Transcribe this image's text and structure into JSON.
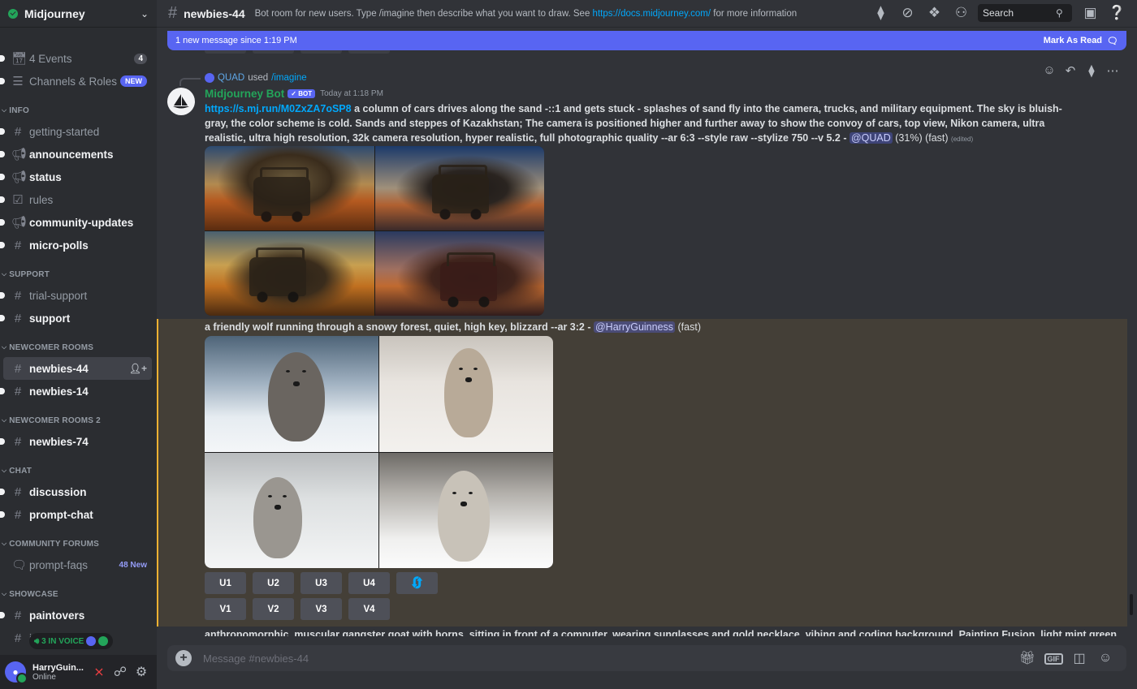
{
  "server": {
    "name": "Midjourney"
  },
  "sidebar": {
    "top_items": [
      {
        "label": "4 Events",
        "icon": "calendar-icon",
        "badge": "4"
      },
      {
        "label": "Channels & Roles",
        "icon": "channels-roles-icon",
        "badge": "NEW"
      }
    ],
    "categories": [
      {
        "name": "INFO",
        "channels": [
          "getting-started",
          "announcements",
          "status",
          "rules",
          "community-updates",
          "micro-polls"
        ]
      },
      {
        "name": "SUPPORT",
        "channels": [
          "trial-support",
          "support"
        ]
      },
      {
        "name": "NEWCOMER ROOMS",
        "channels": [
          "newbies-44",
          "newbies-14"
        ]
      },
      {
        "name": "NEWCOMER ROOMS 2",
        "channels": [
          "newbies-74"
        ]
      },
      {
        "name": "CHAT",
        "channels": [
          "discussion",
          "prompt-chat"
        ]
      },
      {
        "name": "COMMUNITY FORUMS",
        "channels": [
          "prompt-faqs"
        ],
        "forum_badge": "48 New"
      },
      {
        "name": "SHOWCASE",
        "channels": [
          "paintovers",
          "in-the-world"
        ]
      }
    ],
    "voice_pill": "3 IN VOICE"
  },
  "user": {
    "name": "HarryGuin...",
    "status": "Online"
  },
  "topbar": {
    "channel": "newbies-44",
    "topic_prefix": "Bot room for new users. Type /imagine then describe what you want to draw. See ",
    "topic_link": "https://docs.midjourney.com/",
    "topic_suffix": " for more information",
    "search_placeholder": "Search"
  },
  "banner": {
    "text": "1 new message since 1:19 PM",
    "action": "Mark As Read"
  },
  "message1": {
    "reply_user": "QUAD",
    "reply_used": "used",
    "reply_command": "/imagine",
    "author": "Midjourney Bot",
    "bot_tag": "BOT",
    "timestamp": "Today at 1:18 PM",
    "link": "https://s.mj.run/M0ZxZA7oSP8",
    "prompt": " a column of cars drives along the sand -::1 and gets stuck - splashes of sand fly into the camera, trucks, and military equipment. The sky is bluish-gray, the color scheme is cold. Sands and steppes of Kazakhstan; The camera is positioned higher and further away to show the convoy of cars, top view, Nikon camera, ultra realistic, ultra high resolution, 32k camera resolution, hyper realistic, full photographic quality --ar 6:3 --style raw --stylize 750 --v 5.2 - ",
    "mention": "@QUAD",
    "status": " (31%) (fast) ",
    "edited": "(edited)"
  },
  "message2": {
    "prompt": "a friendly wolf running through a snowy forest, quiet, high key, blizzard --ar 3:2 - ",
    "mention": "@HarryGuinness",
    "status": " (fast)",
    "upscale_buttons": [
      "U1",
      "U2",
      "U3",
      "U4"
    ],
    "variation_buttons": [
      "V1",
      "V2",
      "V3",
      "V4"
    ]
  },
  "message3": {
    "prompt": "anthropomorphic, muscular gangster goat with horns, sitting in front of a computer, wearing sunglasses and gold necklace, vibing and coding background, Painting Fusion, light mint green"
  },
  "composer": {
    "placeholder": "Message #newbies-44"
  },
  "colors": {
    "accent": "#5865f2",
    "online": "#23a55a",
    "link": "#00a8fc",
    "highlight": "#f0b132"
  }
}
